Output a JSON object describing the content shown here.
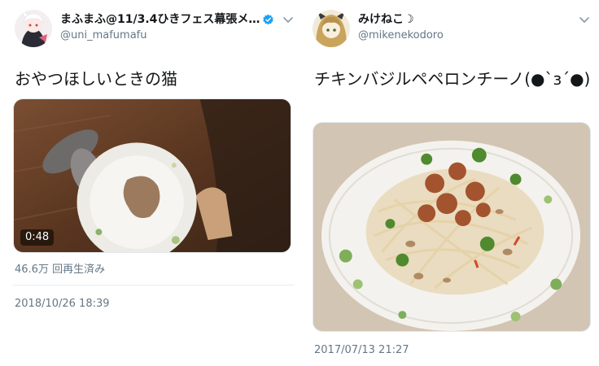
{
  "tweets": [
    {
      "display_name": "まふまふ@11/3.4ひきフェス幕張メ…",
      "handle": "@uni_mafumafu",
      "verified": true,
      "text": "おやつほしいときの猫",
      "media": {
        "type": "video",
        "duration": "0:48"
      },
      "views": "46.6万 回再生済み",
      "timestamp": "2018/10/26 18:39"
    },
    {
      "display_name": "みけねこ☽",
      "handle": "@mikenekodoro",
      "verified": false,
      "text": "チキンバジルペペロンチーノ(●`з´●)",
      "media": {
        "type": "photo"
      },
      "timestamp": "2017/07/13 21:27"
    }
  ],
  "icons": {
    "verified": "verified-badge-icon",
    "caret": "chevron-down-icon"
  },
  "colors": {
    "verified": "#1da1f2",
    "secondary_text": "#657786",
    "primary_text": "#14171a"
  }
}
